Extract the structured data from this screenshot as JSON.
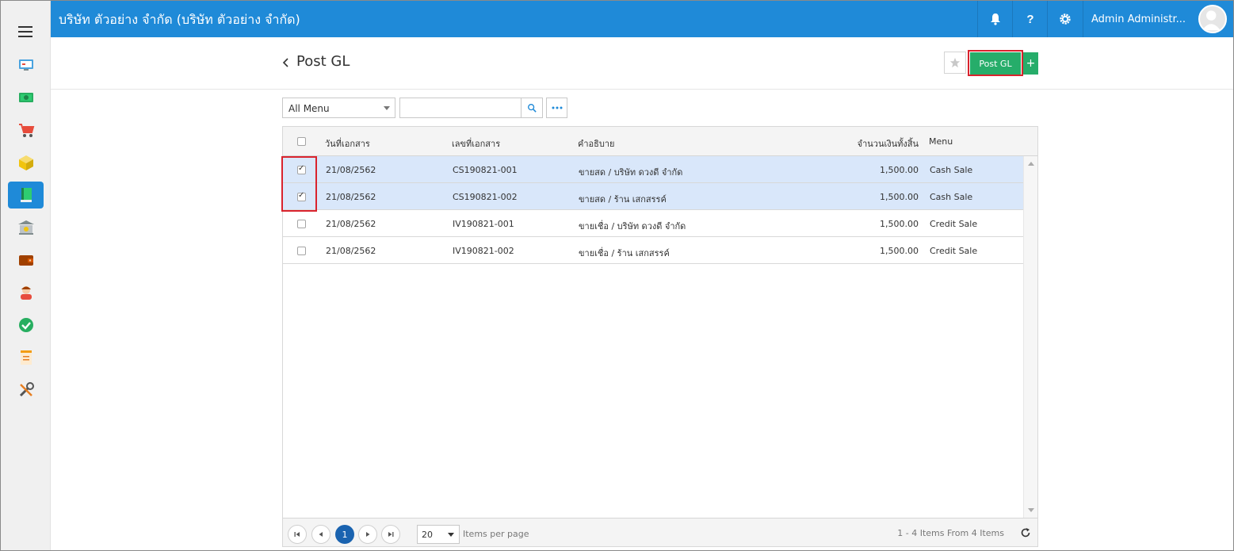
{
  "topbar": {
    "company": "บริษัท ตัวอย่าง จำกัด (บริษัท ตัวอย่าง จำกัด)",
    "user_name": "Admin Administr...",
    "icons": [
      "bell-icon",
      "help-icon",
      "settings-icon"
    ]
  },
  "sidebar": {
    "items": [
      {
        "name": "dashboard-icon"
      },
      {
        "name": "money-icon"
      },
      {
        "name": "cart-icon"
      },
      {
        "name": "box-icon"
      },
      {
        "name": "ledger-icon",
        "active": true
      },
      {
        "name": "bank-icon"
      },
      {
        "name": "wallet-icon"
      },
      {
        "name": "people-icon"
      },
      {
        "name": "approve-icon"
      },
      {
        "name": "report-icon"
      },
      {
        "name": "tools-icon"
      }
    ]
  },
  "page": {
    "title": "Post GL",
    "post_button": "Post GL",
    "add_button": "+"
  },
  "filter": {
    "menu_value": "All Menu",
    "search_value": ""
  },
  "grid": {
    "headers": [
      "วันที่เอกสาร",
      "เลขที่เอกสาร",
      "คำอธิบาย",
      "จำนวนเงินทั้งสิ้น",
      "Menu"
    ],
    "rows": [
      {
        "checked": true,
        "date": "21/08/2562",
        "doc_no": "CS190821-001",
        "desc": "ขายสด / บริษัท ดวงดี จำกัด",
        "amount": "1,500.00",
        "menu": "Cash Sale"
      },
      {
        "checked": true,
        "date": "21/08/2562",
        "doc_no": "CS190821-002",
        "desc": "ขายสด / ร้าน เสกสรรค์",
        "amount": "1,500.00",
        "menu": "Cash Sale"
      },
      {
        "checked": false,
        "date": "21/08/2562",
        "doc_no": "IV190821-001",
        "desc": "ขายเชื่อ / บริษัท ดวงดี จำกัด",
        "amount": "1,500.00",
        "menu": "Credit Sale"
      },
      {
        "checked": false,
        "date": "21/08/2562",
        "doc_no": "IV190821-002",
        "desc": "ขายเชื่อ / ร้าน เสกสรรค์",
        "amount": "1,500.00",
        "menu": "Credit Sale"
      }
    ]
  },
  "pager": {
    "current_page": "1",
    "page_size": "20",
    "items_per_page_label": "Items per page",
    "info": "1 - 4 Items From 4 Items"
  },
  "colors": {
    "brand": "#1f8ad8",
    "primary_action": "#26ad6a",
    "highlight_frame": "#d9232d",
    "selected_row": "#d9e7fa"
  }
}
